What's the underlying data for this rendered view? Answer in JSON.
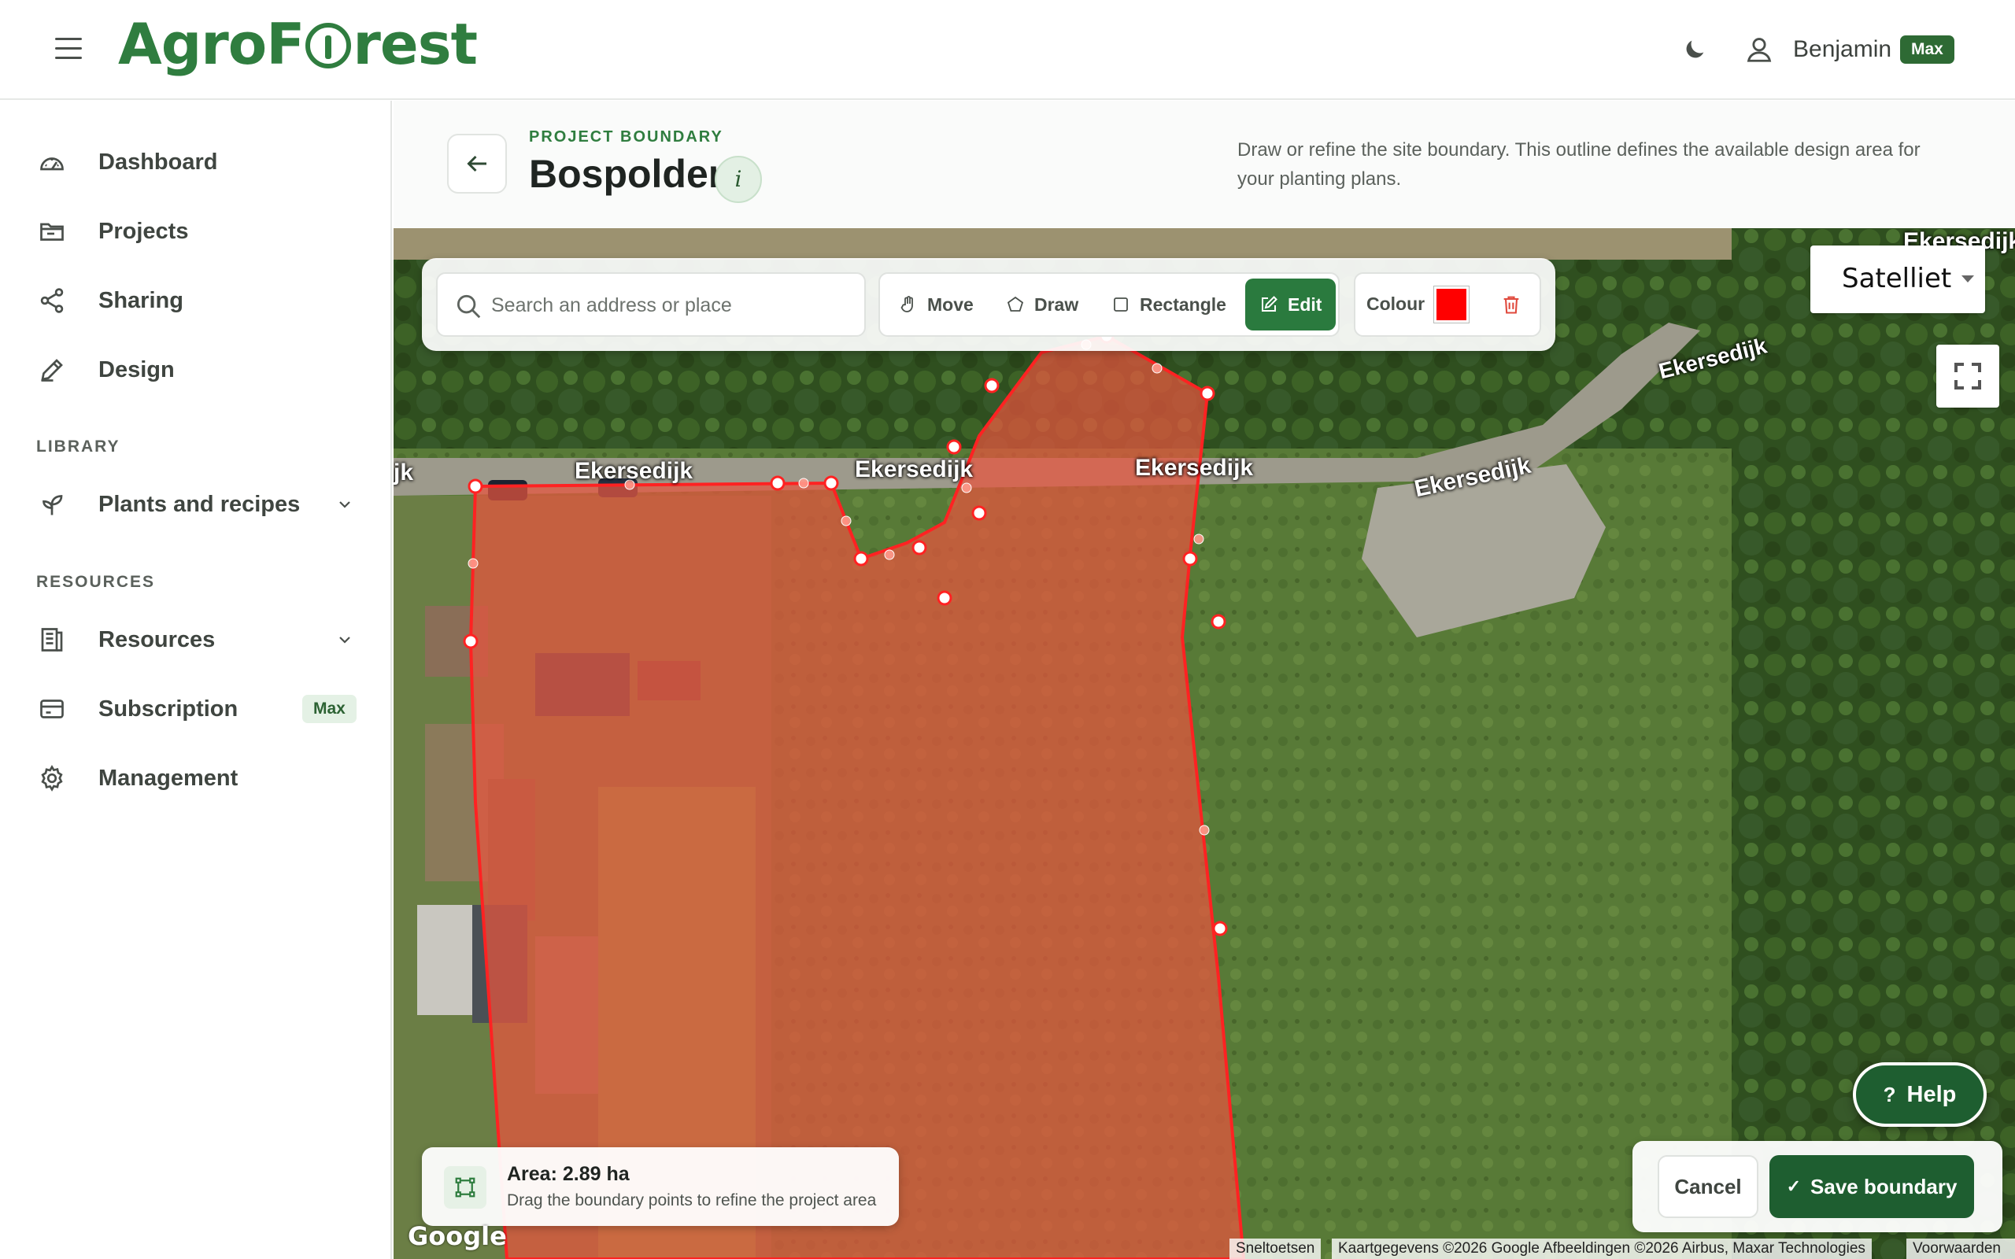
{
  "app": {
    "brand_prefix": "AgroF",
    "brand_suffix": "rest",
    "user_name": "Benjamin",
    "plan_badge": "Max"
  },
  "sidebar": {
    "items": [
      {
        "label": "Dashboard",
        "icon": "dashboard-gauge-icon"
      },
      {
        "label": "Projects",
        "icon": "folder-icon"
      },
      {
        "label": "Sharing",
        "icon": "share-icon"
      },
      {
        "label": "Design",
        "icon": "pencil-icon"
      }
    ],
    "library_label": "LIBRARY",
    "library_items": [
      {
        "label": "Plants and recipes",
        "icon": "sprout-icon",
        "expandable": true
      }
    ],
    "resources_label": "RESOURCES",
    "resource_items": [
      {
        "label": "Resources",
        "icon": "book-icon",
        "expandable": true
      },
      {
        "label": "Subscription",
        "icon": "card-icon",
        "badge": "Max"
      },
      {
        "label": "Management",
        "icon": "gear-icon"
      }
    ]
  },
  "page": {
    "eyebrow": "PROJECT BOUNDARY",
    "title": "Bospolder",
    "info_label": "i",
    "description": "Draw or refine the site boundary. This outline defines the available design area for your planting plans."
  },
  "toolbar": {
    "search_placeholder": "Search an address or place",
    "tools": [
      {
        "label": "Move",
        "icon": "hand-icon",
        "active": false
      },
      {
        "label": "Draw",
        "icon": "pentagon-icon",
        "active": false
      },
      {
        "label": "Rectangle",
        "icon": "square-icon",
        "active": false
      },
      {
        "label": "Edit",
        "icon": "edit-icon",
        "active": true
      }
    ],
    "colour_label": "Colour",
    "colour_value": "#ff0000"
  },
  "map": {
    "map_type": "Satelliet",
    "road_labels": [
      "jk",
      "Ekersedijk",
      "Ekersedijk",
      "Ekersedijk",
      "Ekersedijk",
      "Ekersedijk",
      "Ekersedijk"
    ],
    "google_logo": "Google",
    "attribution": {
      "shortcuts": "Sneltoetsen",
      "data": "Kaartgegevens ©2026 Google Afbeeldingen ©2026 Airbus, Maxar Technologies",
      "terms": "Voorwaarden"
    }
  },
  "area": {
    "title": "Area: 2.89 ha",
    "subtitle": "Drag the boundary points to refine the project area"
  },
  "actions": {
    "help": "Help",
    "cancel": "Cancel",
    "save": "Save boundary"
  },
  "colors": {
    "brand_green": "#2f7d3f",
    "dark_green": "#1e5e30",
    "boundary_fill": "#e8553f",
    "boundary_stroke": "#ff2222"
  }
}
